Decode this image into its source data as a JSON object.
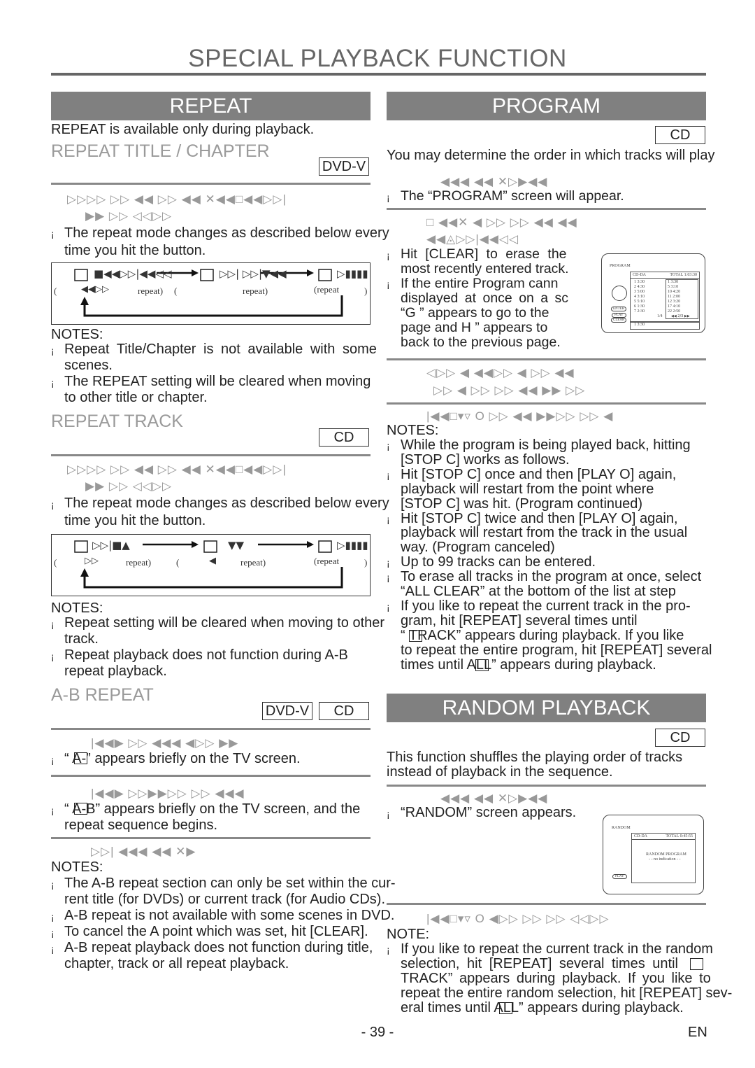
{
  "title": "SPECIAL PLAYBACK FUNCTION",
  "repeat": {
    "banner": "REPEAT",
    "intro": "REPEAT is available only during playback.",
    "title_chapter": {
      "heading": "REPEAT TITLE / CHAPTER",
      "badge": "DVD-V",
      "glyph1": "▷▷▷▷  ▷▷  ◀◀  ▷▷      ◀◀  ✕◀◀□◀◀▷▷|",
      "glyph2": "▶▶  ▷▷ ◁◁▷▷",
      "bullet": [
        "The repeat mode changes as described below every",
        "time you hit the button."
      ],
      "diagram": {
        "l1": "(",
        "l2": "◀◀▷▷",
        "l3": "repeat)",
        "l4": "(",
        "l5": "repeat)",
        "l6": "(repeat",
        "l7": ")",
        "g1": "■◀◀▷▷|◀◀◁◁",
        "g2": "▷▷| ▷▷|▼◀◀",
        "g3": "▷▮▮▮▮"
      },
      "notes_label": "NOTES:",
      "notes": [
        "Repeat Title/Chapter is not available with some",
        "scenes.",
        "The REPEAT setting will be cleared when moving",
        "to other title or chapter."
      ]
    },
    "track": {
      "heading": "REPEAT TRACK",
      "badge": "CD",
      "glyph1": "▷▷▷▷  ▷▷  ◀◀  ▷▷      ◀◀  ✕◀◀□◀◀▷▷|",
      "glyph2": "▶▶  ▷▷ ◁◁▷▷",
      "bullet": [
        "The repeat mode changes as described below every",
        "time you hit the button."
      ],
      "diagram": {
        "l1": "(",
        "l2": "▷▷",
        "l3": "repeat)",
        "l4": "(",
        "l5": "◀",
        "l6": "repeat)",
        "l7": "(repeat",
        "l8": ")",
        "g1": "▷▷|■▲",
        "g2": "▼▼",
        "g3": "▷▮▮▮▮"
      },
      "notes_label": "NOTES:",
      "notes": [
        "Repeat setting will be cleared when moving to other",
        "track.",
        "Repeat playback does not function during A-B",
        "repeat playback."
      ]
    },
    "ab": {
      "heading": "A-B REPEAT",
      "badge1": "DVD-V",
      "badge2": "CD",
      "glyph1": "|◀◀▶ ▷▷   ◀◀◀ ◀▷▷  ▶▶",
      "step1": [
        "“   A-” appears briefly on the TV screen."
      ],
      "glyph2": "|◀◀▶ ▷▷▶▶▷▷  ▷▷    ◀◀◀",
      "step2": [
        "“   A-B” appears briefly on the TV screen, and the",
        "repeat sequence begins."
      ],
      "glyph3": "▷▷|   ◀◀◀    ◀◀ ✕▶",
      "notes_label": "NOTES:",
      "notes": [
        "The A-B repeat section can only be set within the cur-",
        "rent title (for DVDs) or current track (for Audio CDs).",
        "A-B repeat is not available with some scenes in DVD.",
        "To cancel the A point which was set, hit [CLEAR].",
        "A-B repeat playback does not function during title,",
        "chapter, track or all repeat playback."
      ]
    }
  },
  "program": {
    "banner": "PROGRAM",
    "badge": "CD",
    "intro": "You may determine the order in which tracks will play",
    "glyph1": "◀◀◀   ◀◀ ✕▷▶◀◀",
    "step1": "The “PROGRAM” screen will appear.",
    "glyph2": "□ ◀◀✕    ◀   ▷▷  ▷▷   ◀◀  ◀◀",
    "glyph3": "◀◀◬▷▷|◀◀◁◁",
    "bullets": [
      "Hit [CLEAR] to erase the",
      "most recently entered track.",
      "If the entire Program cann",
      "displayed at once on a sc",
      "“G  ” appears to go to the",
      "page and H  ” appears to",
      "back to the previous page."
    ],
    "screen": {
      "title": "PROGRAM",
      "disc": "CD-DA",
      "total": "TOTAL 1:03:30",
      "left": [
        "1  3:30",
        "2  4:30",
        "3  5:00",
        "4  3:10",
        "5  5:10",
        "6  1:30",
        "7  2:30"
      ],
      "right": [
        "1  3:30",
        "5  3:10",
        "10  4:20",
        "11  2:00",
        "12  3:20",
        "17  4:10",
        "22  2:50"
      ],
      "page": "1/4",
      "pager": "◀◀ 2/3 ▶▶",
      "bottom": "1  3:30",
      "enter": "ENTER",
      "play": "PLAY",
      "clear": "CLEAR"
    },
    "glyph4": "◁▷▷ ◀       ◀◀▷▷ ◀    ▷▷  ◀◀",
    "glyph5": "▷▷ ◀  ▷▷    ▷▷  ◀◀  ▶▶ ▷▷",
    "glyph6": "|◀◀□▾▿  O   ▷▷ ◀◀  ▶▶▷▷    ▷▷ ◀",
    "notes_label": "NOTES:",
    "notes": [
      "While the program is being played back, hitting",
      "[STOP C] works as follows.",
      "Hit [STOP C] once and then [PLAY O] again,",
      "playback will restart from the point where",
      "[STOP C] was hit. (Program continued)",
      "Hit [STOP C] twice and then [PLAY O] again,",
      "playback will restart from the track in the usual",
      "way. (Program canceled)",
      "Up to 99 tracks can be entered.",
      "To erase all tracks in the program at once, select",
      "“ALL CLEAR” at the bottom of the list at step",
      "If you like to repeat the current track in the pro-",
      "gram, hit [REPEAT] several times until",
      "“    TRACK” appears during playback. If you like",
      "to repeat the entire program, hit [REPEAT] several",
      "times until       ALL” appears during playback."
    ],
    "bullet_rows": [
      0,
      2,
      5,
      8,
      9,
      11
    ]
  },
  "random": {
    "banner": "RANDOM PLAYBACK",
    "badge": "CD",
    "intro": [
      "This function shuffles the playing order of tracks",
      "instead of playback in the sequence."
    ],
    "glyph1": "◀◀◀   ◀◀ ✕▷▶◀◀",
    "step1": "“RANDOM” screen appears.",
    "screen": {
      "title": "RANDOM",
      "disc": "CD-DA",
      "total": "TOTAL 0:45:55",
      "msg": "RANDOM PROGRAM",
      "sub": "- - no indication - -",
      "play": "PLAY"
    },
    "glyph2": "|◀◀□▾▿  O   ◀▷▷  ▷▷    ▷▷ ◁◁▷▷",
    "note_label": "NOTE:",
    "note": [
      "If you like to repeat the current track in the random",
      "selection, hit [REPEAT] several times until",
      "TRACK” appears during playback. If you like to",
      "repeat the entire random selection, hit [REPEAT] sev-",
      "eral times until       ALL” appears during playback."
    ]
  },
  "footer": {
    "page": "- 39 -",
    "lang": "EN"
  }
}
